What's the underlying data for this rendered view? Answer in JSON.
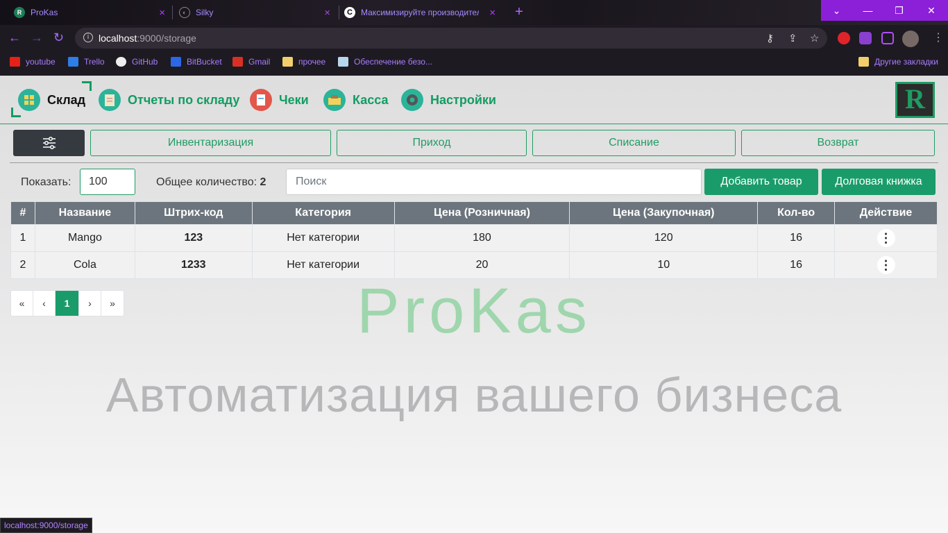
{
  "browser": {
    "tabs": [
      {
        "title": "ProKas"
      },
      {
        "title": "Silky"
      },
      {
        "title": "Максимизируйте производител"
      }
    ],
    "url_host": "localhost",
    "url_path": ":9000/storage",
    "bookmarks": [
      "youtube",
      "Trello",
      "GitHub",
      "BitBucket",
      "Gmail",
      "прочее",
      "Обеспечение безо...",
      "Другие закладки"
    ],
    "status_url": "localhost:9000/storage",
    "accent": "#8c1fd8"
  },
  "nav": {
    "items": [
      "Склад",
      "Отчеты по складу",
      "Чеки",
      "Касса",
      "Настройки"
    ],
    "active": "Склад",
    "logo": "R",
    "accent": "#1a9c6a"
  },
  "actions": {
    "inventory": "Инвентаризация",
    "income": "Приход",
    "writeoff": "Списание",
    "return": "Возврат"
  },
  "toolbar": {
    "show_label": "Показать:",
    "show_value": "100",
    "total_label": "Общее количество:",
    "total_value": "2",
    "search_placeholder": "Поиск",
    "add_button": "Добавить товар",
    "debt_button": "Долговая книжка"
  },
  "table": {
    "headers": [
      "#",
      "Название",
      "Штрих-код",
      "Категория",
      "Цена (Розничная)",
      "Цена (Закупочная)",
      "Кол-во",
      "Действие"
    ],
    "rows": [
      [
        "1",
        "Mango",
        "123",
        "Нет категории",
        "180",
        "120",
        "16"
      ],
      [
        "2",
        "Cola",
        "1233",
        "Нет категории",
        "20",
        "10",
        "16"
      ]
    ]
  },
  "pagination": {
    "first": "«",
    "prev": "‹",
    "current": "1",
    "next": "›",
    "last": "»"
  },
  "watermark": {
    "brand": "ProKas",
    "tagline": "Автоматизация вашего бизнеса"
  }
}
